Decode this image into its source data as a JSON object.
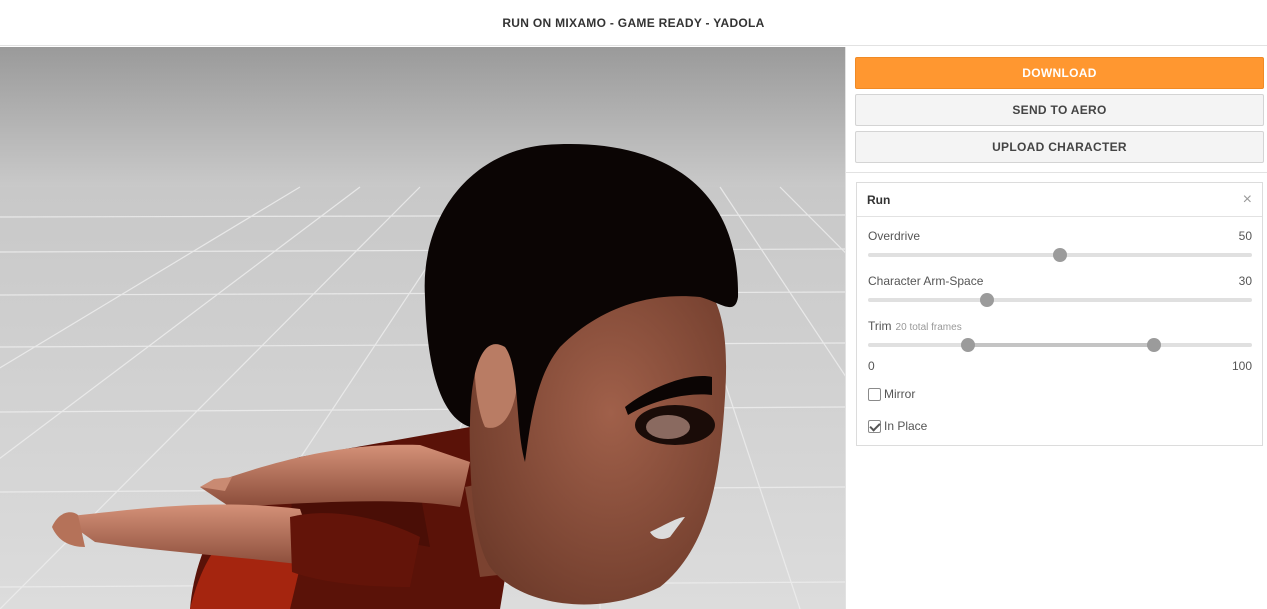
{
  "header": {
    "title": "RUN ON MIXAMO - GAME READY - YADOLA"
  },
  "actions": {
    "download_label": "DOWNLOAD",
    "send_label": "SEND TO AERO",
    "upload_label": "UPLOAD CHARACTER"
  },
  "animation": {
    "name": "Run",
    "close_icon": "×",
    "overdrive": {
      "label": "Overdrive",
      "value": "50",
      "level": 0.5
    },
    "arm_space": {
      "label": "Character Arm-Space",
      "value": "30",
      "level": 0.31
    },
    "trim": {
      "label": "Trim",
      "subtitle": "20 total frames",
      "min_label": "0",
      "max_label": "100",
      "start": 0.26,
      "end": 0.745
    },
    "mirror": {
      "label": "Mirror",
      "checked": false
    },
    "in_place": {
      "label": "In Place",
      "checked": true
    }
  },
  "colors": {
    "accent": "#ff9730",
    "thumb": "#9b9b9b"
  },
  "icons": {
    "close": "close-icon"
  }
}
